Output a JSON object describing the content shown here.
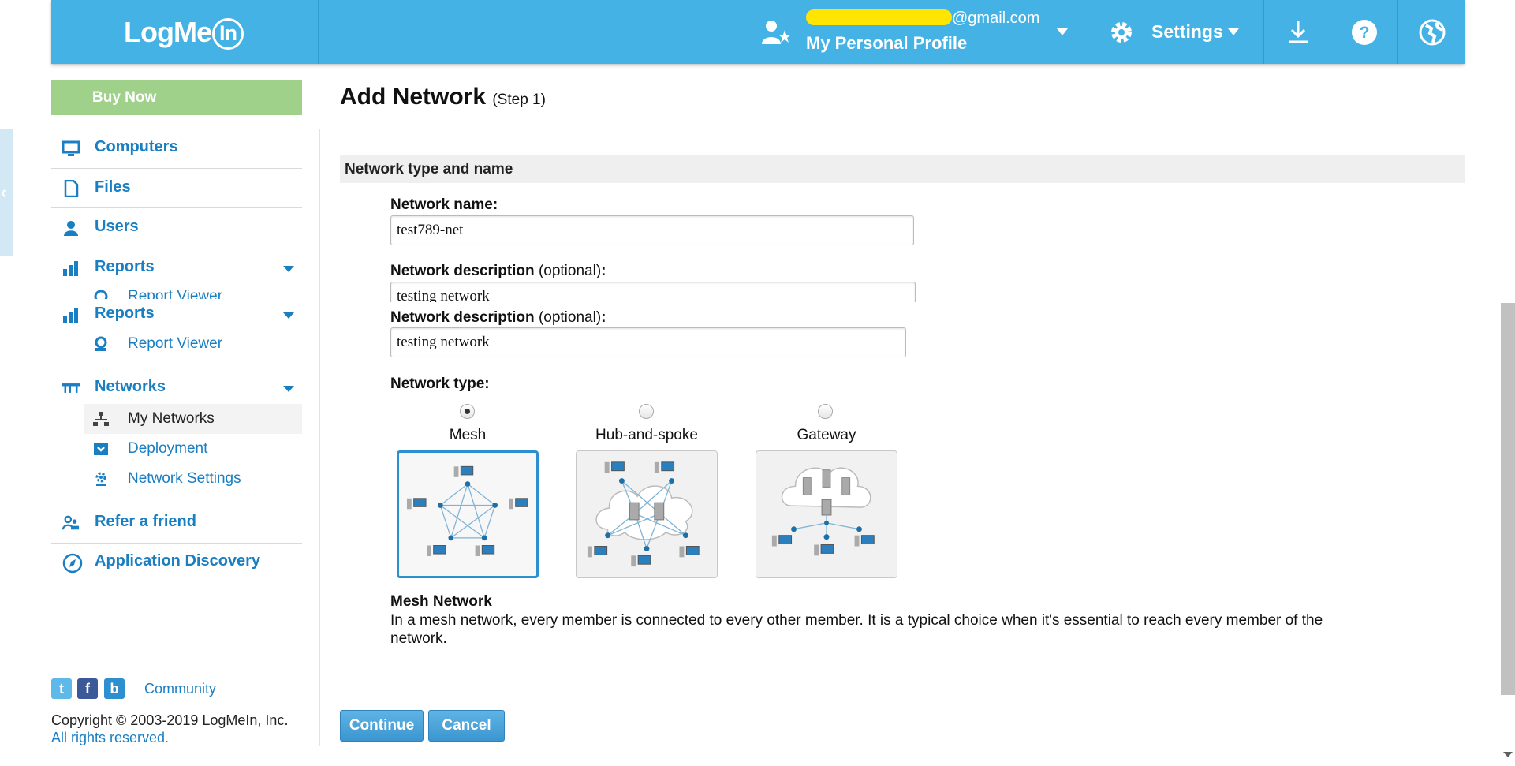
{
  "header": {
    "logo_text": "LogMe",
    "logo_in": "In",
    "email_suffix": "@gmail.com",
    "profile_name": "My Personal Profile",
    "settings_label": "Settings"
  },
  "sidebar": {
    "buy_now": "Buy Now",
    "computers": "Computers",
    "files": "Files",
    "users": "Users",
    "reports": "Reports",
    "report_viewer": "Report Viewer",
    "reports_2": "Reports",
    "report_viewer_2": "Report Viewer",
    "networks": "Networks",
    "my_networks": "My Networks",
    "deployment": "Deployment",
    "network_settings": "Network Settings",
    "refer_friend": "Refer a friend",
    "app_discovery": "Application Discovery",
    "left_tab_glyph": "‹"
  },
  "footer": {
    "community": "Community",
    "copyright": "Copyright © 2003-2019 LogMeIn, Inc.",
    "rights": "All rights reserved."
  },
  "main": {
    "title": "Add Network",
    "step": "(Step 1)",
    "section": "Network type and name",
    "name_label": "Network name:",
    "name_value": "test789-net",
    "desc_label": "Network description",
    "desc_optional": "(optional)",
    "desc_colon": ":",
    "desc_value": "testing network",
    "type_label": "Network type:",
    "types": [
      {
        "label": "Mesh",
        "checked": true
      },
      {
        "label": "Hub-and-spoke",
        "checked": false
      },
      {
        "label": "Gateway",
        "checked": false
      }
    ],
    "selected_title": "Mesh Network",
    "selected_desc": "In a mesh network, every member is connected to every other member. It is a typical choice when it's essential to reach every member of the network.",
    "continue": "Continue",
    "cancel": "Cancel"
  },
  "colors": {
    "header_bg": "#45b2e5",
    "link": "#1a7fc2",
    "buy_now_bg": "#9fd18a",
    "selected_border": "#2b8fd0"
  }
}
